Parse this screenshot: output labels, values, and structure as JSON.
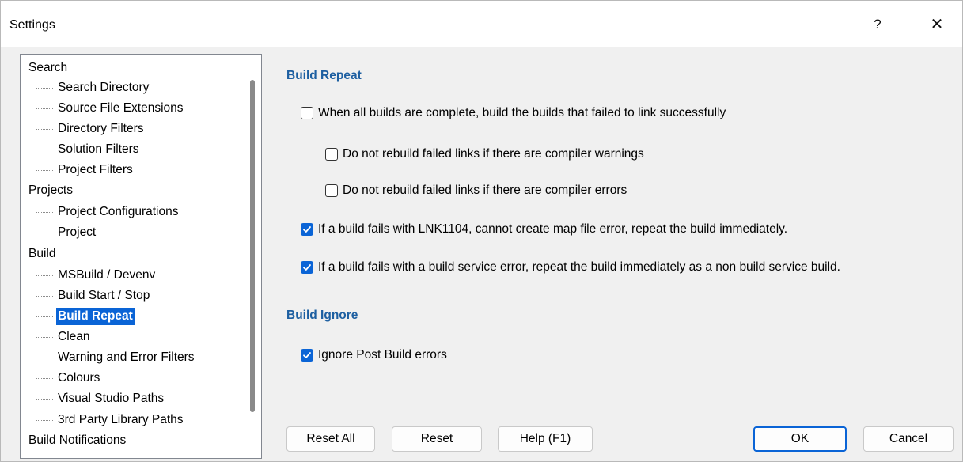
{
  "window": {
    "title": "Settings",
    "help_label": "?",
    "close_label": "✕"
  },
  "tree": {
    "categories": [
      {
        "label": "Search",
        "children": [
          "Search Directory",
          "Source File Extensions",
          "Directory Filters",
          "Solution Filters",
          "Project Filters"
        ]
      },
      {
        "label": "Projects",
        "children": [
          "Project Configurations",
          "Project"
        ]
      },
      {
        "label": "Build",
        "children": [
          "MSBuild / Devenv",
          "Build Start / Stop",
          "Build Repeat",
          "Clean",
          "Warning and Error Filters",
          "Colours",
          "Visual Studio Paths",
          "3rd Party Library Paths"
        ]
      },
      {
        "label": "Build Notifications",
        "children": []
      }
    ],
    "selected": "Build Repeat"
  },
  "main": {
    "build_repeat": {
      "heading": "Build Repeat",
      "options": [
        {
          "label": "When all builds are complete, build the builds that failed to link successfully",
          "checked": false
        },
        {
          "label": "Do not rebuild failed links if there are compiler warnings",
          "checked": false
        },
        {
          "label": "Do not rebuild failed links if there are compiler errors",
          "checked": false
        },
        {
          "label": "If a build fails with LNK1104, cannot create map file error, repeat the build immediately.",
          "checked": true
        },
        {
          "label": "If a build fails with a build service error, repeat the build immediately as a non build service build.",
          "checked": true
        }
      ]
    },
    "build_ignore": {
      "heading": "Build Ignore",
      "options": [
        {
          "label": "Ignore Post Build errors",
          "checked": true
        }
      ]
    }
  },
  "buttons": {
    "reset_all": "Reset All",
    "reset": "Reset",
    "help": "Help (F1)",
    "ok": "OK",
    "cancel": "Cancel"
  },
  "colors": {
    "accent": "#0a64d6",
    "section_heading": "#1d5fa1"
  }
}
